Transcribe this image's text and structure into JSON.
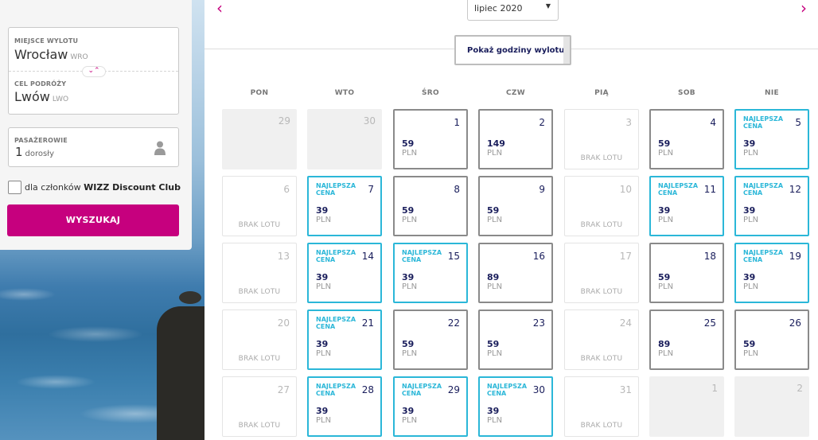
{
  "search": {
    "origin_label": "MIEJSCE WYLOTU",
    "origin_city": "Wrocław",
    "origin_code": "WRO",
    "destination_label": "CEL PODRÓŻY",
    "destination_city": "Lwów",
    "destination_code": "LWO",
    "swap_icon": "⌄⌃",
    "passengers_label": "PASAŻEROWIE",
    "passengers_count": "1",
    "passengers_type": "dorosły",
    "club_prefix": "dla członków",
    "club_name": "WIZZ Discount Club",
    "search_button": "WYSZUKAJ"
  },
  "calendar": {
    "prev_icon": "‹",
    "next_icon": "›",
    "month": "lipiec 2020",
    "caret": "▼",
    "show_hours_button": "Pokaż godziny wylotu",
    "best_label": "NAJLEPSZA CENA",
    "no_flight_label": "BRAK LOTU",
    "currency": "PLN",
    "weekdays": [
      "PON",
      "WTO",
      "ŚRO",
      "CZW",
      "PIĄ",
      "SOB",
      "NIE"
    ],
    "days": [
      {
        "day": "29",
        "state": "out",
        "price": "",
        "best": false
      },
      {
        "day": "30",
        "state": "out",
        "price": "",
        "best": false
      },
      {
        "day": "1",
        "state": "avail",
        "price": "59",
        "best": false
      },
      {
        "day": "2",
        "state": "avail",
        "price": "149",
        "best": false
      },
      {
        "day": "3",
        "state": "none",
        "price": "",
        "best": false
      },
      {
        "day": "4",
        "state": "avail",
        "price": "59",
        "best": false
      },
      {
        "day": "5",
        "state": "avail",
        "price": "39",
        "best": true
      },
      {
        "day": "6",
        "state": "none",
        "price": "",
        "best": false
      },
      {
        "day": "7",
        "state": "avail",
        "price": "39",
        "best": true
      },
      {
        "day": "8",
        "state": "avail",
        "price": "59",
        "best": false
      },
      {
        "day": "9",
        "state": "avail",
        "price": "59",
        "best": false
      },
      {
        "day": "10",
        "state": "none",
        "price": "",
        "best": false
      },
      {
        "day": "11",
        "state": "avail",
        "price": "39",
        "best": true
      },
      {
        "day": "12",
        "state": "avail",
        "price": "39",
        "best": true
      },
      {
        "day": "13",
        "state": "none",
        "price": "",
        "best": false
      },
      {
        "day": "14",
        "state": "avail",
        "price": "39",
        "best": true
      },
      {
        "day": "15",
        "state": "avail",
        "price": "39",
        "best": true
      },
      {
        "day": "16",
        "state": "avail",
        "price": "89",
        "best": false
      },
      {
        "day": "17",
        "state": "none",
        "price": "",
        "best": false
      },
      {
        "day": "18",
        "state": "avail",
        "price": "59",
        "best": false
      },
      {
        "day": "19",
        "state": "avail",
        "price": "39",
        "best": true
      },
      {
        "day": "20",
        "state": "none",
        "price": "",
        "best": false
      },
      {
        "day": "21",
        "state": "avail",
        "price": "39",
        "best": true
      },
      {
        "day": "22",
        "state": "avail",
        "price": "59",
        "best": false
      },
      {
        "day": "23",
        "state": "avail",
        "price": "59",
        "best": false
      },
      {
        "day": "24",
        "state": "none",
        "price": "",
        "best": false
      },
      {
        "day": "25",
        "state": "avail",
        "price": "89",
        "best": false
      },
      {
        "day": "26",
        "state": "avail",
        "price": "59",
        "best": false
      },
      {
        "day": "27",
        "state": "none",
        "price": "",
        "best": false
      },
      {
        "day": "28",
        "state": "avail",
        "price": "39",
        "best": true
      },
      {
        "day": "29",
        "state": "avail",
        "price": "39",
        "best": true
      },
      {
        "day": "30",
        "state": "avail",
        "price": "39",
        "best": true
      },
      {
        "day": "31",
        "state": "none",
        "price": "",
        "best": false
      },
      {
        "day": "1",
        "state": "out",
        "price": "",
        "best": false
      },
      {
        "day": "2",
        "state": "out",
        "price": "",
        "best": false
      }
    ]
  },
  "colors": {
    "brand": "#c6007e",
    "best_price": "#2bb7d8",
    "navy": "#1a1e5c"
  }
}
